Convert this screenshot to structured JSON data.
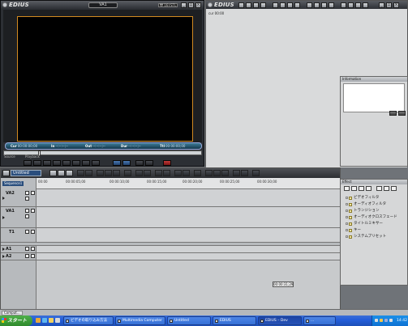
{
  "player": {
    "logo": "EDIUS",
    "rec_label": "VA1",
    "format_badges": [
      "₩ 16",
      "STL"
    ],
    "timecodes": [
      {
        "label": "Cur",
        "value": "00:00:00;00"
      },
      {
        "label": "In",
        "value": "--:--:--;--"
      },
      {
        "label": "Out",
        "value": "--:--:--;--"
      },
      {
        "label": "Dur",
        "value": "--:--:--;--"
      },
      {
        "label": "Ttl",
        "value": "00:00:00;00"
      }
    ],
    "scrub_labels": [
      "Source",
      "Playback"
    ]
  },
  "recorder": {
    "logo": "EDIUS",
    "timecode": "cur 00:00"
  },
  "information": {
    "title": "Information"
  },
  "timeline": {
    "sequence_tab": "Untitled",
    "sequence_label": "Sequence1",
    "ruler_labels": [
      "00:00",
      "00:00:05;00",
      "00:00:10;00",
      "00:00:15;00",
      "00:00:20;00",
      "00:00:25;00",
      "00:00:30;00"
    ],
    "tracks": [
      "VA2",
      "VA1",
      "T1",
      "A1",
      "A2"
    ],
    "footer_tc": "00:00:31;29"
  },
  "effect": {
    "title": "Effect",
    "items": [
      "ビデオフィルタ",
      "オーディオフィルタ",
      "トランジション",
      "オーディオクロスフェード",
      "タイトルミキサー",
      "キー",
      "システムプリセット"
    ]
  },
  "status_bar": {
    "tab": "Comput..."
  },
  "taskbar": {
    "start_label": "スタート",
    "buttons": [
      {
        "label": "ビデオの取り込み方法"
      },
      {
        "label": "Multimedia Computer"
      },
      {
        "label": "Untitled"
      },
      {
        "label": "EDIUS"
      },
      {
        "label": "EDIUS – Dev"
      },
      {
        "label": "..."
      }
    ],
    "clock": "14:42"
  }
}
